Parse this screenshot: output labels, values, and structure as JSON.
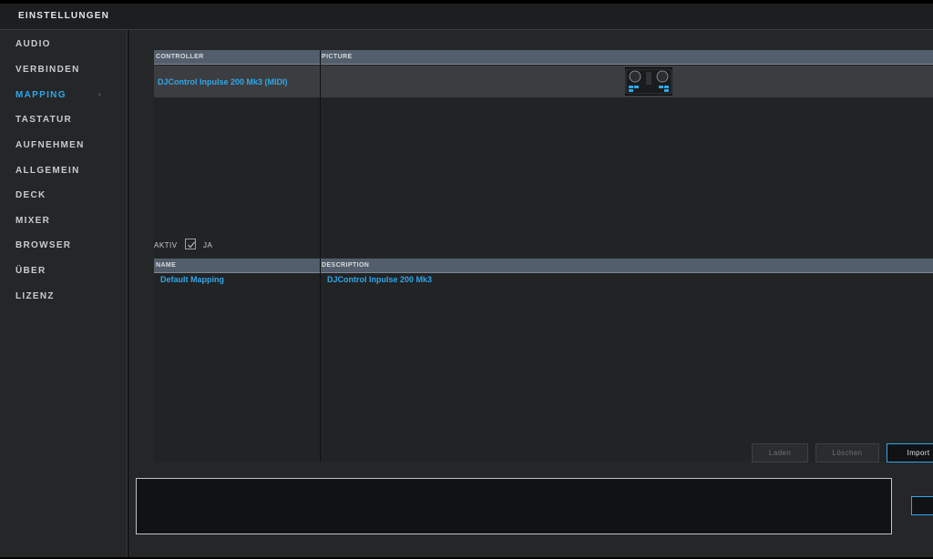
{
  "window": {
    "title": "EINSTELLUNGEN"
  },
  "sidebar": {
    "items": [
      {
        "label": "AUDIO"
      },
      {
        "label": "VERBINDEN"
      },
      {
        "label": "MAPPING",
        "active": true
      },
      {
        "label": "TASTATUR"
      },
      {
        "label": "AUFNEHMEN"
      },
      {
        "label": "ALLGEMEIN"
      },
      {
        "label": "DECK"
      },
      {
        "label": "MIXER"
      },
      {
        "label": "BROWSER"
      },
      {
        "label": "ÜBER"
      },
      {
        "label": "LIZENZ"
      }
    ],
    "active_arrow": "›"
  },
  "controllers_table": {
    "columns": [
      "CONTROLLER",
      "PICTURE"
    ],
    "rows": [
      {
        "controller": "DJControl Inpulse 200 Mk3 (MIDI)",
        "picture_icon": "dj-controller-thumbnail"
      }
    ]
  },
  "aktiv": {
    "label": "AKTIV",
    "checked": true,
    "value_label": "JA"
  },
  "mappings_table": {
    "columns": [
      "NAME",
      "DESCRIPTION"
    ],
    "rows": [
      {
        "name": "Default Mapping",
        "description": "DJControl Inpulse 200 Mk3"
      }
    ]
  },
  "buttons": {
    "load": "Laden",
    "delete": "Löschen",
    "import": "Import"
  },
  "colors": {
    "accent": "#2fa7e8",
    "header": "#525e6b",
    "background": "#252628"
  }
}
